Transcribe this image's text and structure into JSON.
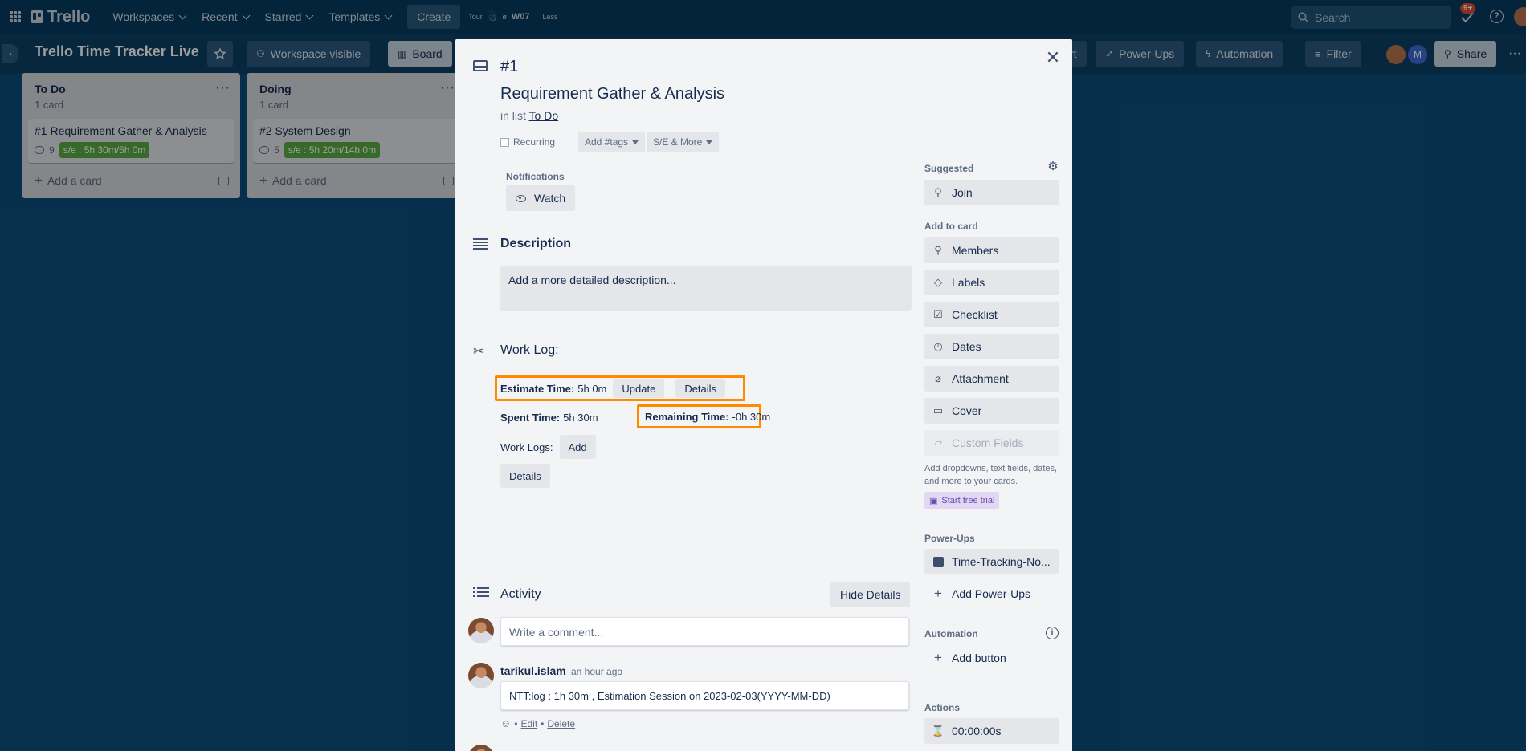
{
  "topnav": {
    "logo": "Trello",
    "workspaces": "Workspaces",
    "recent": "Recent",
    "starred": "Starred",
    "templates": "Templates",
    "create": "Create",
    "tour": "Tour",
    "w07": "W07",
    "less": "Less",
    "search_placeholder": "Search",
    "notifications_badge": "9+"
  },
  "boardbar": {
    "title": "Trello Time Tracker Live",
    "visibility": "Workspace visible",
    "board_view": "Board",
    "power_ups": "Power-Ups",
    "automation": "Automation",
    "filter": "Filter",
    "share": "Share",
    "member_initial": "M",
    "partial_label": "rt"
  },
  "lists": [
    {
      "title": "To Do",
      "count": "1 card",
      "cards": [
        {
          "title": "#1 Requirement Gather & Analysis",
          "comments": "9",
          "badge": "s/e : 5h 30m/5h 0m"
        }
      ],
      "add_card": "Add a card"
    },
    {
      "title": "Doing",
      "count": "1 card",
      "cards": [
        {
          "title": "#2 System Design",
          "comments": "5",
          "badge": "s/e : 5h 20m/14h 0m"
        }
      ],
      "add_card": "Add a card"
    }
  ],
  "modal": {
    "card_number": "#1",
    "title": "Requirement Gather & Analysis",
    "in_list_prefix": "in list",
    "list_name": "To Do",
    "recurring": "Recurring",
    "add_tags": "Add #tags",
    "se_more": "S/E & More",
    "notifications_label": "Notifications",
    "watch": "Watch",
    "description_title": "Description",
    "description_placeholder": "Add a more detailed description...",
    "worklog": {
      "title": "Work Log:",
      "estimate_label": "Estimate Time:",
      "estimate_value": "5h 0m",
      "update": "Update",
      "details": "Details",
      "spent_label": "Spent Time:",
      "spent_value": "5h 30m",
      "remaining_label": "Remaining Time:",
      "remaining_value": "-0h 30m",
      "worklogs_label": "Work Logs:",
      "add": "Add",
      "details2": "Details"
    },
    "activity": {
      "title": "Activity",
      "hide_details": "Hide Details",
      "comment_placeholder": "Write a comment...",
      "username": "tarikul.islam",
      "time_ago": "an hour ago",
      "comment": "NTT:log : 1h 30m , Estimation Session on 2023-02-03(YYYY-MM-DD)",
      "edit": "Edit",
      "delete": "Delete",
      "bullet": "•"
    },
    "sidebar": {
      "suggested": "Suggested",
      "join": "Join",
      "add_to_card": "Add to card",
      "members": "Members",
      "labels": "Labels",
      "checklist": "Checklist",
      "dates": "Dates",
      "attachment": "Attachment",
      "cover": "Cover",
      "custom_fields": "Custom Fields",
      "custom_note": "Add dropdowns, text fields, dates, and more to your cards.",
      "start_trial": "Start free trial",
      "power_ups": "Power-Ups",
      "time_tracking": "Time-Tracking-No...",
      "add_power_ups": "Add Power-Ups",
      "automation": "Automation",
      "add_button": "Add button",
      "actions": "Actions",
      "timer": "00:00:00s"
    }
  }
}
